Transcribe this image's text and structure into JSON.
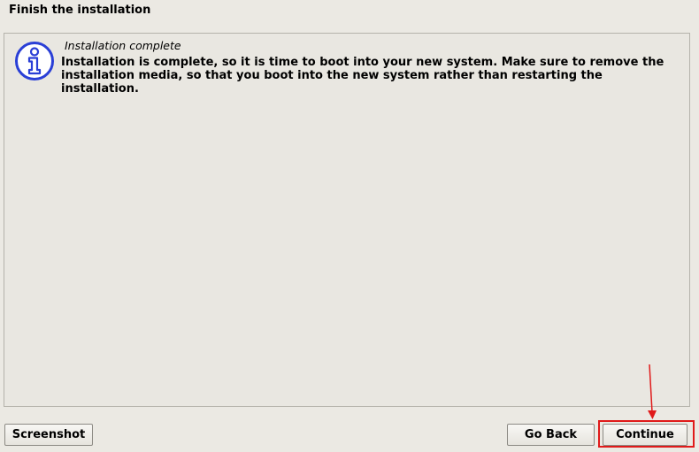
{
  "header": {
    "title": "Finish the installation"
  },
  "message": {
    "icon": "info-icon",
    "heading": "Installation complete",
    "body": "Installation is complete, so it is time to boot into your new system. Make sure to remove the installation media, so that you boot into the new system rather than restarting the installation."
  },
  "buttons": {
    "screenshot": "Screenshot",
    "go_back": "Go Back",
    "continue": "Continue"
  },
  "annotation": {
    "highlight_color": "#e01a1a",
    "target": "continue-button"
  },
  "colors": {
    "background": "#ebe9e3",
    "icon_blue": "#2a3fd6"
  }
}
